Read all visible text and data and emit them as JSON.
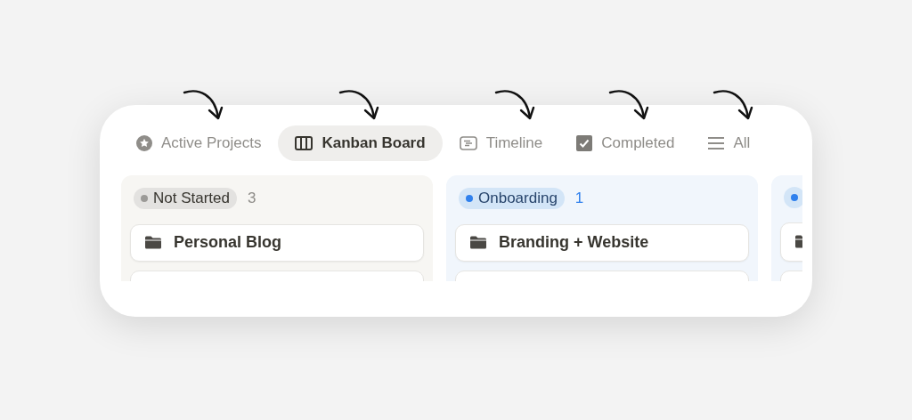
{
  "tabs": [
    {
      "label": "Active Projects",
      "kind": "star",
      "selected": false
    },
    {
      "label": "Kanban Board",
      "kind": "columns",
      "selected": true
    },
    {
      "label": "Timeline",
      "kind": "timeline",
      "selected": false
    },
    {
      "label": "Completed",
      "kind": "check",
      "selected": false
    },
    {
      "label": "All",
      "kind": "list",
      "selected": false
    }
  ],
  "columns": [
    {
      "label": "Not Started",
      "count": "3",
      "color": "#9b9a97",
      "kind": "neutral",
      "cards": [
        {
          "kind": "page",
          "title": "Personal Blog"
        }
      ]
    },
    {
      "label": "Onboarding",
      "count": "1",
      "color": "#2f80ed",
      "kind": "accent",
      "cards": [
        {
          "kind": "page",
          "title": "Branding + Website"
        }
      ]
    },
    {
      "color": "#2f80ed",
      "kind": "accent",
      "cards": [
        {
          "kind": "page"
        }
      ]
    }
  ]
}
